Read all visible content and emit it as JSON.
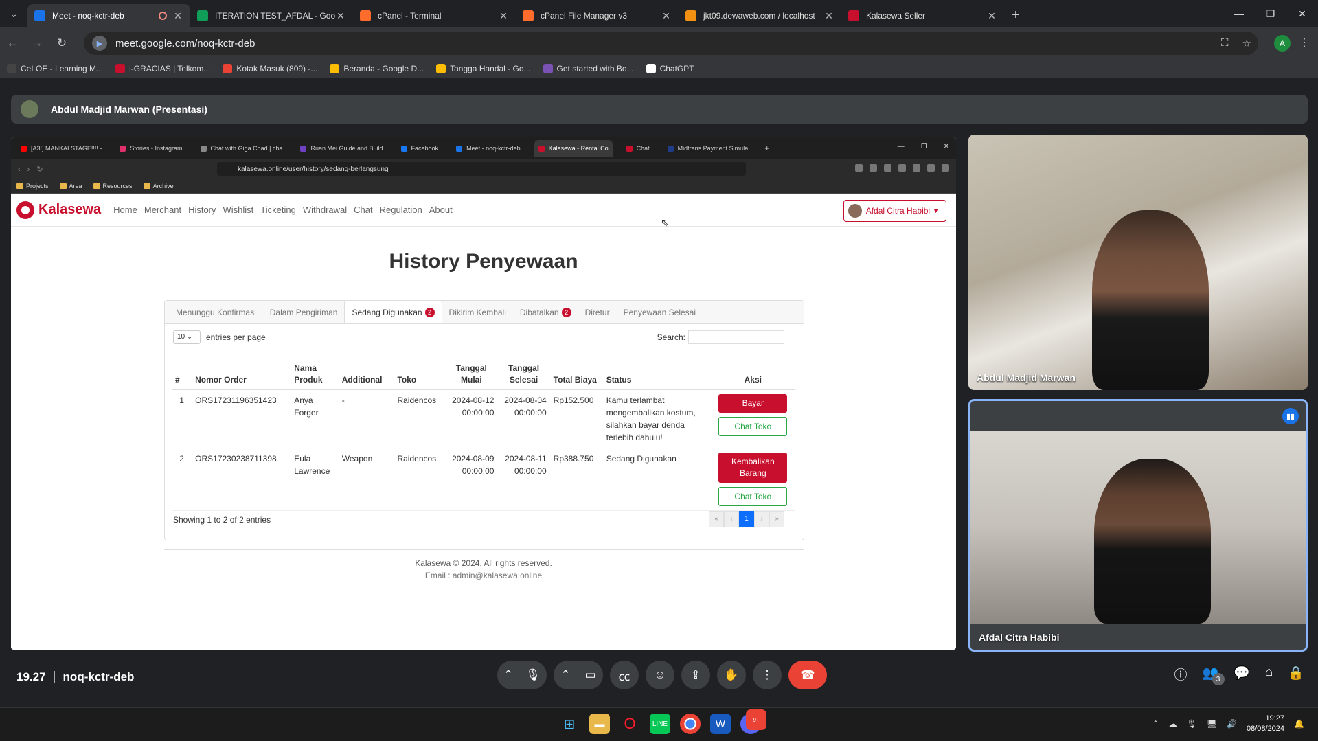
{
  "browser": {
    "tabs": [
      {
        "title": "Meet - noq-kctr-deb",
        "color": "#1a73e8",
        "active": true
      },
      {
        "title": "ITERATION TEST_AFDAL - Goog",
        "color": "#0f9d58"
      },
      {
        "title": "cPanel - Terminal",
        "color": "#ff6c2c"
      },
      {
        "title": "cPanel File Manager v3",
        "color": "#ff6c2c"
      },
      {
        "title": "jkt09.dewaweb.com / localhost",
        "color": "#f29111"
      },
      {
        "title": "Kalasewa Seller",
        "color": "#c8102e"
      }
    ],
    "url": "meet.google.com/noq-kctr-deb",
    "profile_initial": "A",
    "bookmarks": [
      {
        "label": "CeLOE - Learning M...",
        "color": "#444"
      },
      {
        "label": "i-GRACIAS | Telkom...",
        "color": "#c8102e"
      },
      {
        "label": "Kotak Masuk (809) -...",
        "color": "#ea4335"
      },
      {
        "label": "Beranda - Google D...",
        "color": "#fbbc04"
      },
      {
        "label": "Tangga Handal - Go...",
        "color": "#fbbc04"
      },
      {
        "label": "Get started with Bo...",
        "color": "#7952b3"
      },
      {
        "label": "ChatGPT",
        "color": "#ffffff"
      }
    ]
  },
  "meet": {
    "presenter_label": "Abdul Madjid Marwan (Presentasi)",
    "time": "19.27",
    "code": "noq-kctr-deb",
    "participant_count": "3",
    "participants": [
      {
        "name": "Abdul Madjid Marwan"
      },
      {
        "name": "Afdal Citra Habibi"
      }
    ]
  },
  "shared": {
    "tabs": [
      {
        "title": "[A3!] MANKAI STAGE!!!! -",
        "color": "#ff0000"
      },
      {
        "title": "Stories • Instagram",
        "color": "#e1306c"
      },
      {
        "title": "Chat with Giga Chad | cha",
        "color": "#888888"
      },
      {
        "title": "Ruan Mei Guide and Build",
        "color": "#6f42c1"
      },
      {
        "title": "Facebook",
        "color": "#1877f2"
      },
      {
        "title": "Meet - noq-kctr-deb",
        "color": "#1a73e8"
      },
      {
        "title": "Kalasewa - Rental Co",
        "color": "#c8102e",
        "active": true
      },
      {
        "title": "Chat",
        "color": "#c8102e"
      },
      {
        "title": "Midtrans Payment Simula",
        "color": "#1f3c88"
      }
    ],
    "url": "kalasewa.online/user/history/sedang-berlangsung",
    "bookmarks": [
      "Projects",
      "Area",
      "Resources",
      "Archive"
    ]
  },
  "site": {
    "brand": "Kalasewa",
    "menu": [
      "Home",
      "Merchant",
      "History",
      "Wishlist",
      "Ticketing",
      "Withdrawal",
      "Chat",
      "Regulation",
      "About"
    ],
    "user": "Afdal Citra Habibi",
    "title": "History Penyewaan",
    "tabs": [
      {
        "label": "Menunggu Konfirmasi"
      },
      {
        "label": "Dalam Pengiriman"
      },
      {
        "label": "Sedang Digunakan",
        "badge": "2",
        "active": true
      },
      {
        "label": "Dikirim Kembali"
      },
      {
        "label": "Dibatalkan",
        "badge": "2"
      },
      {
        "label": "Diretur"
      },
      {
        "label": "Penyewaan Selesai"
      }
    ],
    "entries_value": "10",
    "entries_label": "entries per page",
    "search_label": "Search:",
    "columns": [
      "#",
      "Nomor Order",
      "Nama Produk",
      "Additional",
      "Toko",
      "Tanggal Mulai",
      "Tanggal Selesai",
      "Total Biaya",
      "Status",
      "Aksi"
    ],
    "rows": [
      {
        "no": "1",
        "order": "ORS17231196351423",
        "produk": "Anya Forger",
        "additional": "-",
        "toko": "Raidencos",
        "mulai": "2024-08-12 00:00:00",
        "selesai": "2024-08-04 00:00:00",
        "biaya": "Rp152.500",
        "status": "Kamu terlambat mengembalikan kostum, silahkan bayar denda terlebih dahulu!",
        "action": "Bayar",
        "chat": "Chat Toko"
      },
      {
        "no": "2",
        "order": "ORS17230238711398",
        "produk": "Eula Lawrence",
        "additional": "Weapon",
        "toko": "Raidencos",
        "mulai": "2024-08-09 00:00:00",
        "selesai": "2024-08-11 00:00:00",
        "biaya": "Rp388.750",
        "status": "Sedang Digunakan",
        "action": "Kembalikan Barang",
        "chat": "Chat Toko"
      }
    ],
    "showing": "Showing 1 to 2 of 2 entries",
    "page": "1",
    "footer": "Kalasewa © 2024. All rights reserved.",
    "email": "Email : admin@kalasewa.online"
  },
  "taskbar": {
    "time": "19:27",
    "date": "08/08/2024",
    "discord_badge": "9+"
  }
}
